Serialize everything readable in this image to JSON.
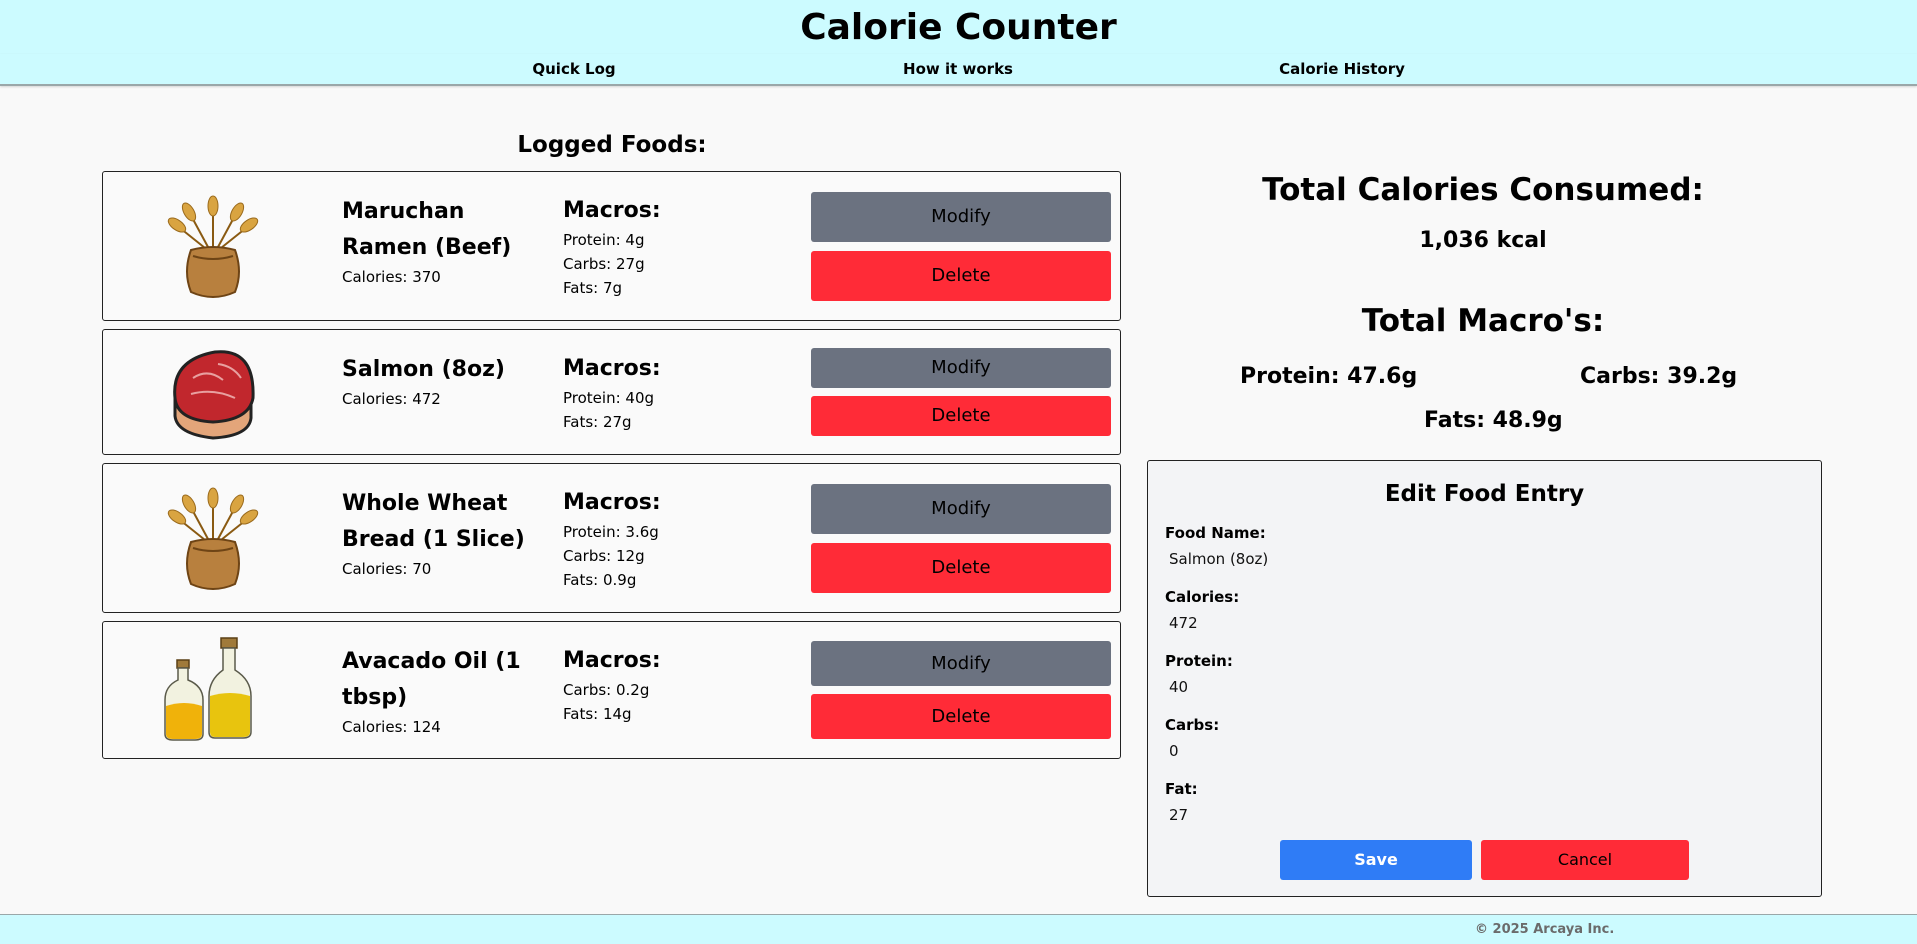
{
  "header": {
    "title": "Calorie Counter"
  },
  "nav": {
    "items": [
      "Quick Log",
      "How it works",
      "Calorie History"
    ]
  },
  "logged": {
    "title": "Logged Foods:",
    "macros_title": "Macros:",
    "modify_label": "Modify",
    "delete_label": "Delete",
    "foods": [
      {
        "name": "Maruchan Ramen (Beef)",
        "calories": "Calories: 370",
        "icon": "wheat-sack-icon",
        "macros": [
          "Protein: 4g",
          "Carbs: 27g",
          "Fats: 7g"
        ]
      },
      {
        "name": "Salmon (8oz)",
        "calories": "Calories: 472",
        "icon": "steak-icon",
        "macros": [
          "Protein: 40g",
          "Fats: 27g"
        ]
      },
      {
        "name": "Whole Wheat Bread (1 Slice)",
        "calories": "Calories: 70",
        "icon": "wheat-sack-icon",
        "macros": [
          "Protein: 3.6g",
          "Carbs: 12g",
          "Fats: 0.9g"
        ]
      },
      {
        "name": "Avacado Oil (1 tbsp)",
        "calories": "Calories: 124",
        "icon": "oil-bottles-icon",
        "macros": [
          "Carbs: 0.2g",
          "Fats: 14g"
        ]
      }
    ]
  },
  "totals": {
    "calories_title": "Total Calories Consumed:",
    "calories_value": "1,036 kcal",
    "macros_title": "Total Macro's:",
    "protein": "Protein: 47.6g",
    "carbs": "Carbs: 39.2g",
    "fats": "Fats: 48.9g"
  },
  "edit": {
    "title": "Edit Food Entry",
    "fields": [
      {
        "label": "Food Name:",
        "value": "Salmon (8oz)"
      },
      {
        "label": "Calories:",
        "value": "472"
      },
      {
        "label": "Protein:",
        "value": "40"
      },
      {
        "label": "Carbs:",
        "value": "0"
      },
      {
        "label": "Fat:",
        "value": "27"
      }
    ],
    "save_label": "Save",
    "cancel_label": "Cancel"
  },
  "footer": {
    "text": "© 2025 Arcaya Inc."
  },
  "colors": {
    "header_bg": "#ccfbff",
    "modify_button": "#6b7280",
    "delete_button": "#ff2b37",
    "save_button": "#2f7cf6"
  }
}
